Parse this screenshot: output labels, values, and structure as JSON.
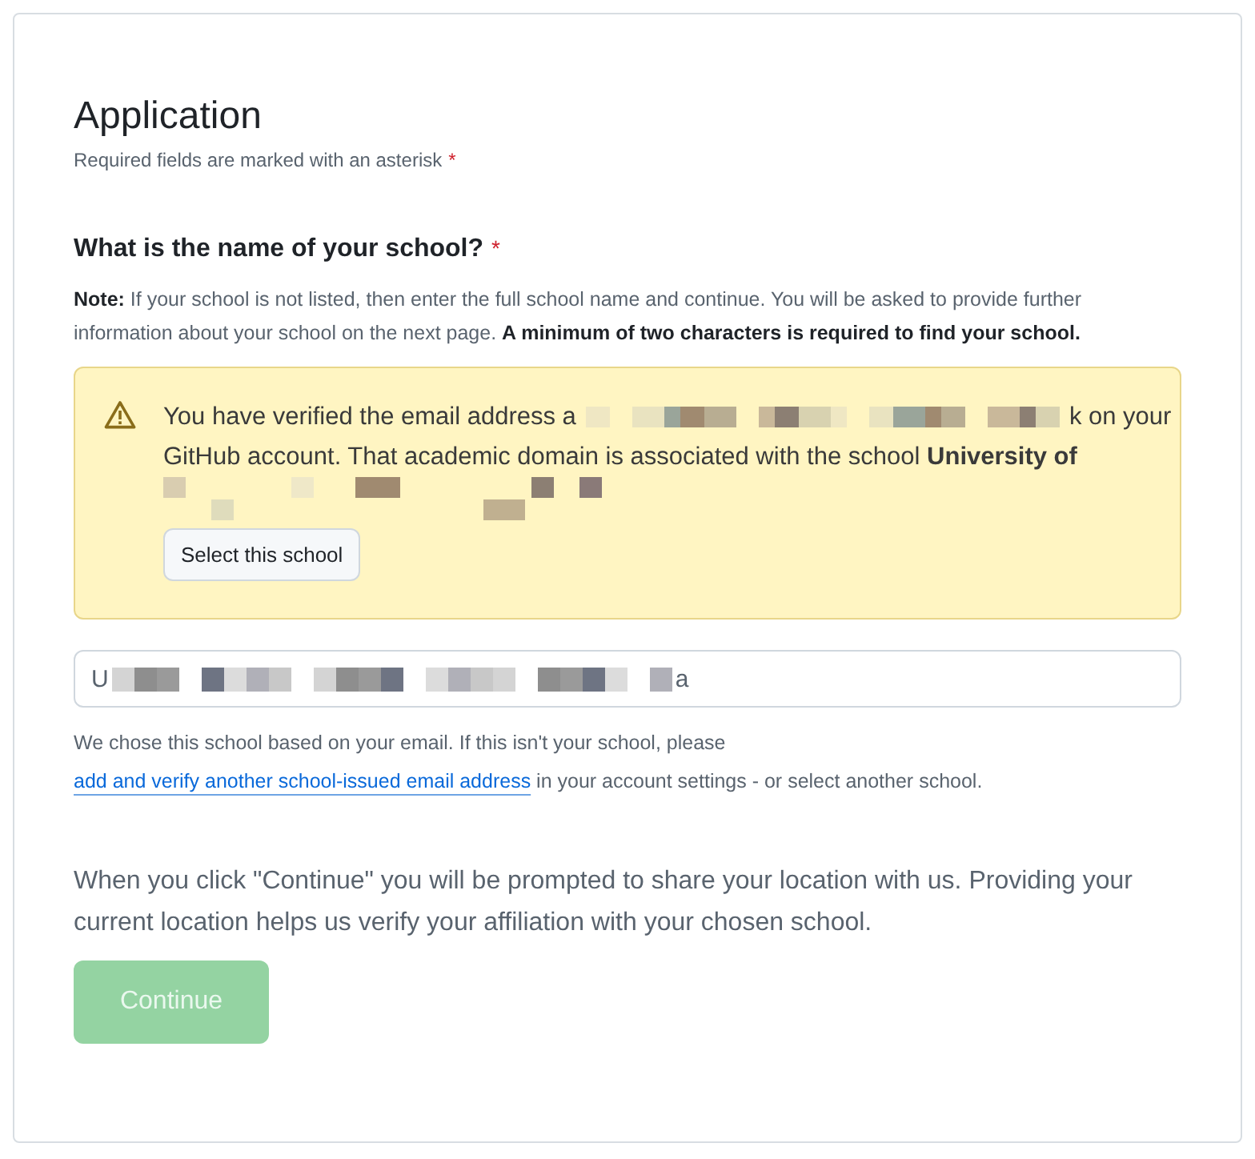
{
  "form": {
    "title": "Application",
    "required_hint": "Required fields are marked with an asterisk",
    "required_mark": "*"
  },
  "question": {
    "label": "What is the name of your school?",
    "required_mark": "*",
    "note": "**Note:** If your school is not listed, then enter the full school name and continue. You will be asked to provide further information about your school on the next page. **A minimum of two characters is required to find your school.**"
  },
  "alert": {
    "text_before": "You have verified the email address a",
    "text_after": "k on your",
    "text_line2": "GitHub account. That academic domain is associated with the school **University of**",
    "button": "Select this school"
  },
  "school_field": {
    "value_start": "U",
    "value_end": "a"
  },
  "help": {
    "before": "We chose this school based on your email. If this isn't your school, please",
    "link": "add and verify another school-issued email address",
    "after": "in your account settings - or select another school."
  },
  "location_note": "When you click \"Continue\" you will be prompted to share your location with us. Providing your current location helps us verify your affiliation with your chosen school.",
  "continue_button": {
    "label": "Continue",
    "disabled": true
  }
}
